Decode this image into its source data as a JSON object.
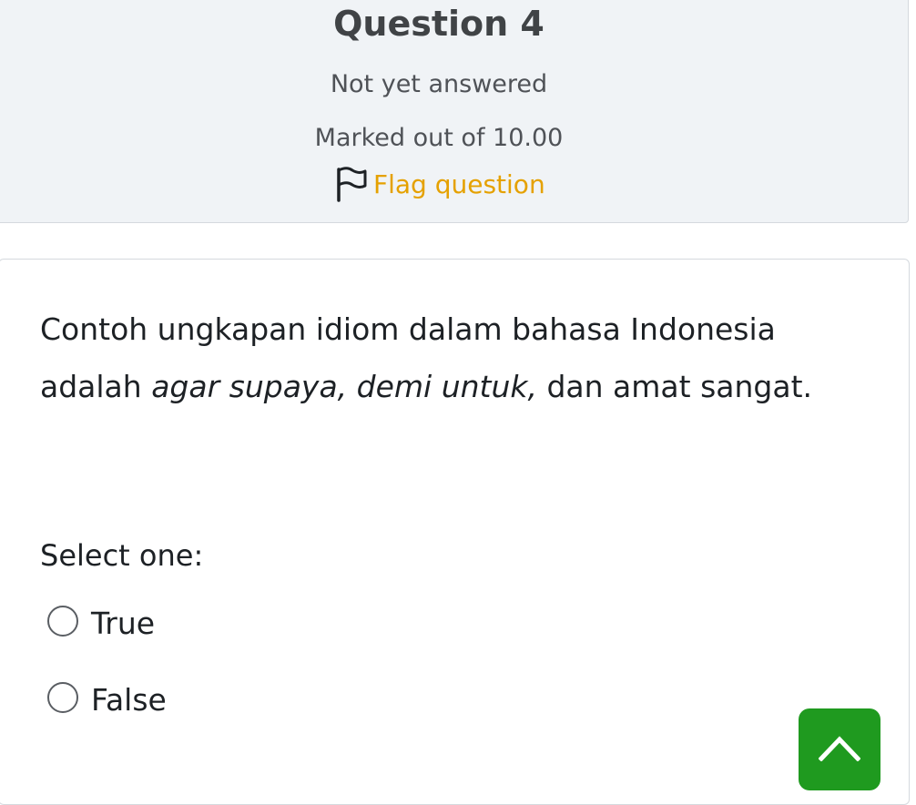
{
  "question_info": {
    "title": "Question 4",
    "status": "Not yet answered",
    "grade": "Marked out of 10.00",
    "flag_label": "Flag question"
  },
  "question": {
    "text_part1": "Contoh ungkapan idiom dalam bahasa Indonesia adalah ",
    "text_italic": "agar supaya, demi untuk,",
    "text_part2": " dan amat sangat.",
    "prompt": "Select one:",
    "options": [
      {
        "label": "True",
        "selected": false
      },
      {
        "label": "False",
        "selected": false
      }
    ]
  },
  "colors": {
    "flag_link": "#e5a100",
    "back_to_top": "#1f9a1f",
    "info_background": "#f0f3f6"
  },
  "icons": {
    "flag": "flag-icon",
    "back_to_top": "chevron-up-icon"
  }
}
